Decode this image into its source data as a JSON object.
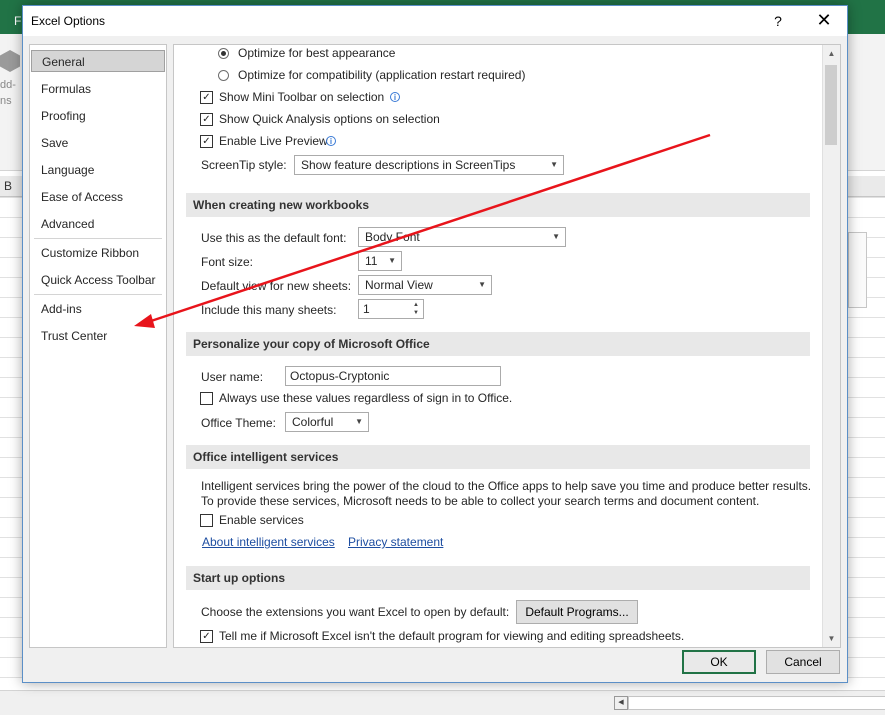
{
  "background": {
    "ribbon_letter": "F",
    "addin_text_1": "dd-",
    "addin_text_2": "ns",
    "column_b": "B"
  },
  "dialog": {
    "title": "Excel Options",
    "help": "?",
    "close": "✕"
  },
  "nav": {
    "items": [
      {
        "label": "General"
      },
      {
        "label": "Formulas"
      },
      {
        "label": "Proofing"
      },
      {
        "label": "Save"
      },
      {
        "label": "Language"
      },
      {
        "label": "Ease of Access"
      },
      {
        "label": "Advanced"
      },
      {
        "label": "Customize Ribbon"
      },
      {
        "label": "Quick Access Toolbar"
      },
      {
        "label": "Add-ins"
      },
      {
        "label": "Trust Center"
      }
    ]
  },
  "ui_options": {
    "radio_best": "Optimize for best appearance",
    "radio_compat": "Optimize for compatibility (application restart required)",
    "mini_toolbar": "Show Mini Toolbar on selection",
    "quick_analysis": "Show Quick Analysis options on selection",
    "live_preview": "Enable Live Preview",
    "screentip_label": "ScreenTip style:",
    "screentip_value": "Show feature descriptions in ScreenTips"
  },
  "new_workbooks": {
    "header": "When creating new workbooks",
    "font_label": "Use this as the default font:",
    "font_value": "Body Font",
    "size_label": "Font size:",
    "size_value": "11",
    "view_label": "Default view for new sheets:",
    "view_value": "Normal View",
    "sheets_label": "Include this many sheets:",
    "sheets_value": "1"
  },
  "personalize": {
    "header": "Personalize your copy of Microsoft Office",
    "username_label": "User name:",
    "username_value": "Octopus-Cryptonic",
    "always_use": "Always use these values regardless of sign in to Office.",
    "theme_label": "Office Theme:",
    "theme_value": "Colorful"
  },
  "intelligent": {
    "header": "Office intelligent services",
    "desc1": "Intelligent services bring the power of the cloud to the Office apps to help save you time and produce better results.",
    "desc2": "To provide these services, Microsoft needs to be able to collect your search terms and document content.",
    "enable": "Enable services",
    "about_link": "About intelligent services",
    "privacy_link": "Privacy statement"
  },
  "startup": {
    "header": "Start up options",
    "extensions_label": "Choose the extensions you want Excel to open by default:",
    "default_programs": "Default Programs...",
    "tell_me": "Tell me if Microsoft Excel isn't the default program for viewing and editing spreadsheets."
  },
  "footer": {
    "ok": "OK",
    "cancel": "Cancel"
  },
  "colors": {
    "accent": "#217346",
    "arrow": "#e8141b"
  }
}
